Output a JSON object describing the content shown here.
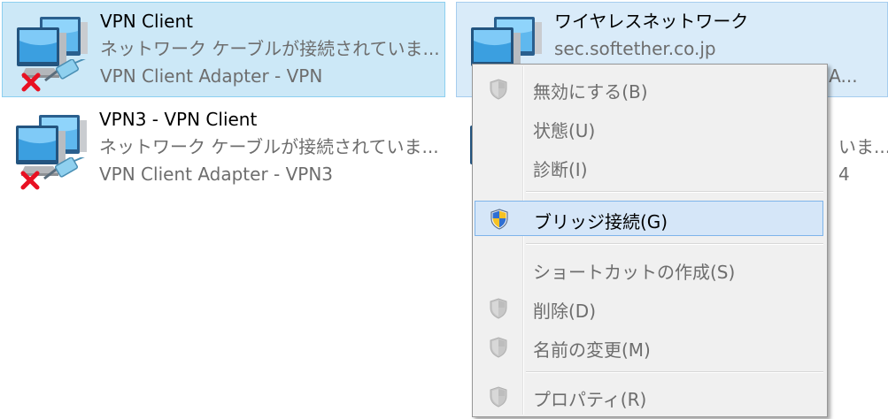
{
  "colors": {
    "selected_bg": "#cce8f7",
    "selected_border": "#8ccff0",
    "menu_bg": "#f0f0f0",
    "menu_hover_bg": "#d5e6f8",
    "menu_hover_border": "#7eb4ea",
    "disabled_text": "#6d6d6d",
    "error_x": "#e81123"
  },
  "connections": [
    {
      "name": "VPN Client",
      "status": "ネットワーク ケーブルが接続されていま...",
      "device": "VPN Client Adapter - VPN",
      "icon": "network-adapter-icon",
      "overlay": "disconnected-x-icon"
    },
    {
      "name": "ワイヤレスネットワーク",
      "status": "sec.softether.co.jp",
      "device": "rk A...",
      "icon": "network-adapter-icon",
      "overlay": "wireless-signal-icon"
    },
    {
      "name": "VPN3 - VPN Client",
      "status": "ネットワーク ケーブルが接続されていま...",
      "device": "VPN Client Adapter - VPN3",
      "icon": "network-adapter-icon",
      "overlay": "disconnected-x-icon"
    },
    {
      "status": "いま...",
      "device": "4",
      "icon": "network-adapter-icon",
      "overlay": "disconnected-x-icon"
    }
  ],
  "context_menu": {
    "items": [
      {
        "label": "無効にする(B)",
        "icon": "shield-icon",
        "enabled": false
      },
      {
        "label": "状態(U)",
        "icon": "",
        "enabled": false
      },
      {
        "label": "診断(I)",
        "icon": "",
        "enabled": false
      },
      {
        "label": "ブリッジ接続(G)",
        "icon": "uac-shield-icon",
        "enabled": true,
        "highlighted": true
      },
      {
        "label": "ショートカットの作成(S)",
        "icon": "",
        "enabled": false
      },
      {
        "label": "削除(D)",
        "icon": "shield-icon",
        "enabled": false
      },
      {
        "label": "名前の変更(M)",
        "icon": "shield-icon",
        "enabled": false
      },
      {
        "label": "プロパティ(R)",
        "icon": "shield-icon",
        "enabled": false
      }
    ]
  }
}
